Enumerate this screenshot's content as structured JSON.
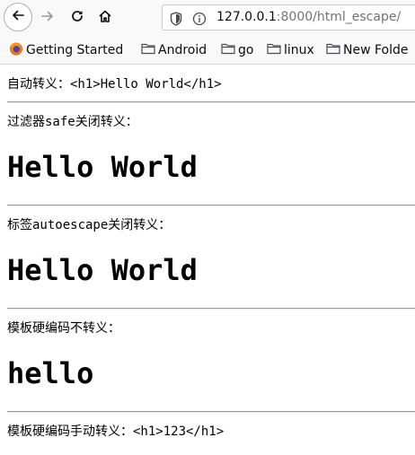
{
  "browser": {
    "url_host": "127.0.0.1",
    "url_port": ":8000",
    "url_path": "/html_escape/",
    "bookmarks": [
      {
        "label": "Getting Started",
        "icon": "firefox-icon"
      },
      {
        "label": "Android",
        "icon": "folder-icon"
      },
      {
        "label": "go",
        "icon": "folder-icon"
      },
      {
        "label": "linux",
        "icon": "folder-icon"
      },
      {
        "label": "New Folde",
        "icon": "folder-icon"
      }
    ]
  },
  "page": {
    "section1": {
      "label": "自动转义：",
      "value": "<h1>Hello World</h1>"
    },
    "section2": {
      "label_cjk_1": "过滤器",
      "label_mono": "safe",
      "label_cjk_2": "关闭转义：",
      "heading": "Hello World"
    },
    "section3": {
      "label_cjk_1": "标签",
      "label_mono": "autoescape",
      "label_cjk_2": "关闭转义：",
      "heading": "Hello World"
    },
    "section4": {
      "label": "模板硬编码不转义：",
      "heading": "hello"
    },
    "section5": {
      "label": "模板硬编码手动转义：",
      "value": "<h1>123</h1>"
    }
  }
}
